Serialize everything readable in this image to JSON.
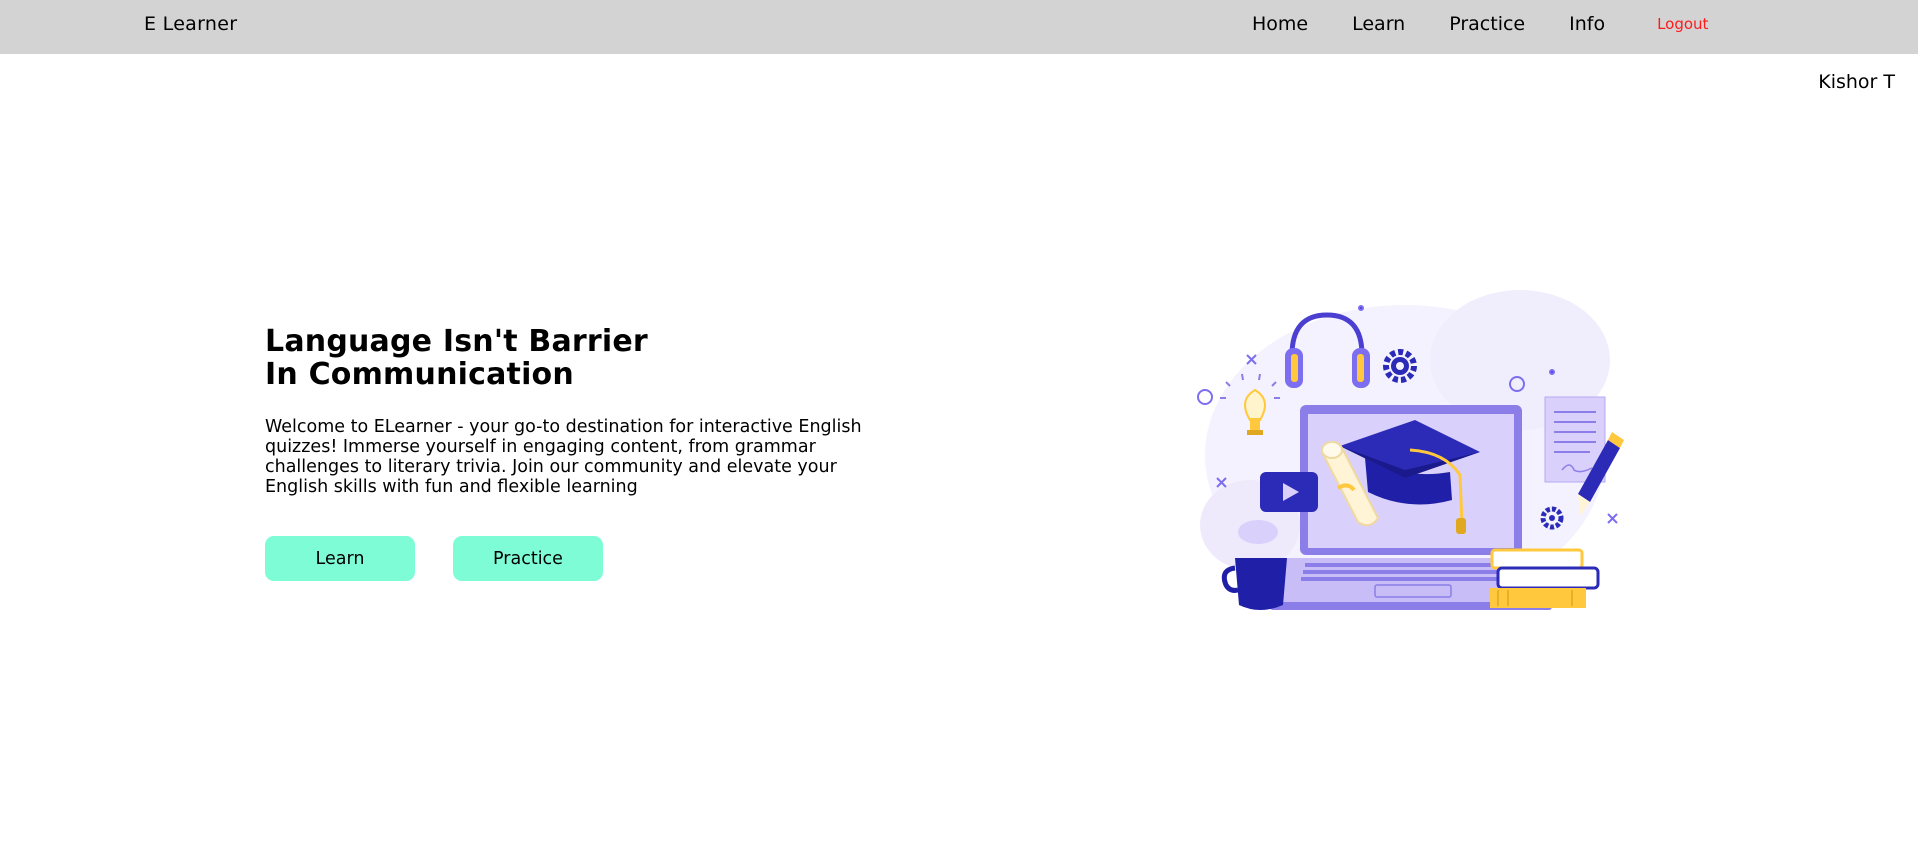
{
  "nav": {
    "brand": "E Learner",
    "links": [
      "Home",
      "Learn",
      "Practice",
      "Info"
    ],
    "logout": "Logout"
  },
  "user": {
    "name": "Kishor T"
  },
  "hero": {
    "title": "Language Isn't Barrier\nIn Communication",
    "description": "Welcome to ELearner - your go-to destination for interactive English quizzes! Immerse yourself in engaging content, from grammar challenges to literary trivia. Join our community and elevate your English skills with fun and flexible learning",
    "buttons": {
      "learn": "Learn",
      "practice": "Practice"
    }
  },
  "colors": {
    "navbar": "#d3d3d3",
    "button": "#7efcd6",
    "logout": "#ff1a1a",
    "illustration_primary": "#1f1fa8",
    "illustration_purple": "#8b7ee8",
    "illustration_light": "#d9d0fb",
    "illustration_yellow": "#ffc83d"
  }
}
